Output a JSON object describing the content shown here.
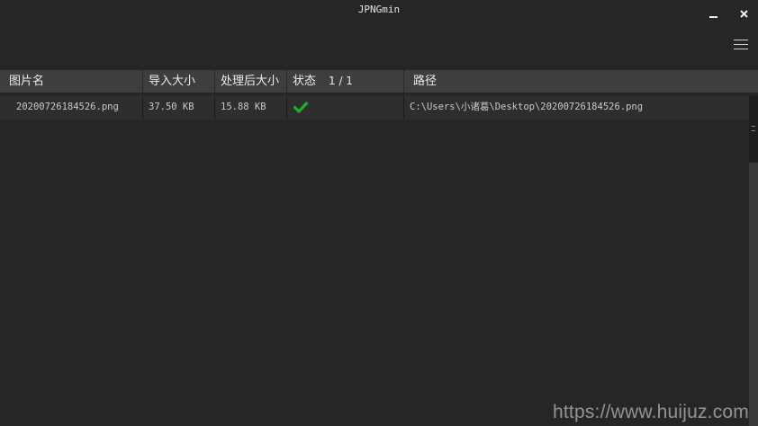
{
  "app": {
    "title": "JPNGmin"
  },
  "icons": {
    "minimize": "minimize-icon",
    "close": "close-icon",
    "menu": "hamburger-menu-icon",
    "status_ok": "checkmark-icon"
  },
  "colors": {
    "background": "#262626",
    "header": "#3e3e3e",
    "row": "#2e2e2e",
    "success": "#22b022"
  },
  "table": {
    "headers": {
      "name": "图片名",
      "input_size": "导入大小",
      "output_size": "处理后大小",
      "status": "状态",
      "path": "路径"
    },
    "progress": "1 / 1",
    "rows": [
      {
        "name": "20200726184526.png",
        "input_size": "37.50 KB",
        "output_size": "15.88 KB",
        "status": "done",
        "path": "C:\\Users\\小诸葛\\Desktop\\20200726184526.png"
      }
    ]
  },
  "watermark": "https://www.huijuz.com"
}
